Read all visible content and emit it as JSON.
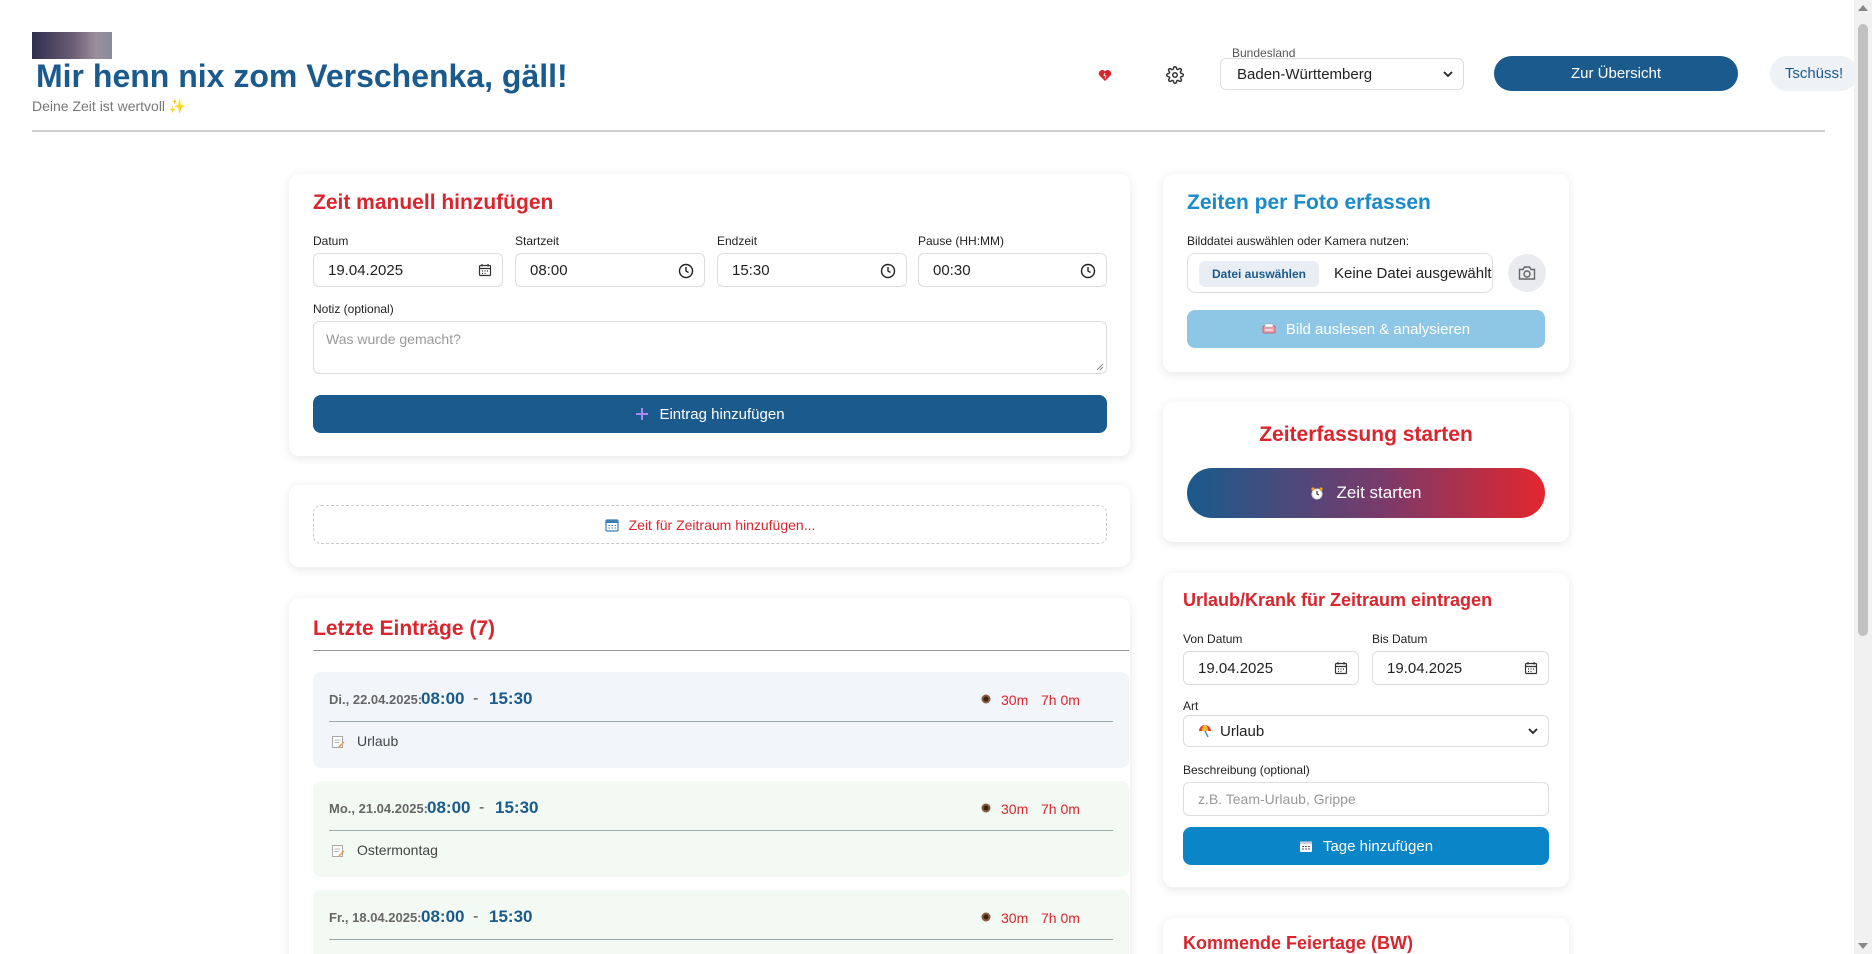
{
  "header": {
    "title": "Mir henn nix zom Verschenka, gäll!",
    "subtitle": "Deine Zeit ist wertvoll ✨",
    "region_label": "Bundesland",
    "region_value": "Baden-Württemberg",
    "overview_label": "Zur Übersicht",
    "logout_label": "Tschüss!"
  },
  "manual": {
    "title": "Zeit manuell hinzufügen",
    "date_label": "Datum",
    "date_value": "19.04.2025",
    "start_label": "Startzeit",
    "start_value": "08:00",
    "end_label": "Endzeit",
    "end_value": "15:30",
    "pause_label": "Pause (HH:MM)",
    "pause_value": "00:30",
    "note_label": "Notiz (optional)",
    "note_placeholder": "Was wurde gemacht?",
    "add_label": "Eintrag hinzufügen"
  },
  "range_add_label": "Zeit für Zeitraum hinzufügen...",
  "recent": {
    "title": "Letzte Einträge (7)",
    "entries": [
      {
        "date": "Di., 22.04.2025:",
        "start": "08:00",
        "end": "15:30",
        "pause": "30m",
        "duration": "7h 0m",
        "note": "Urlaub"
      },
      {
        "date": "Mo., 21.04.2025:",
        "start": "08:00",
        "end": "15:30",
        "pause": "30m",
        "duration": "7h 0m",
        "note": "Ostermontag"
      },
      {
        "date": "Fr., 18.04.2025:",
        "start": "08:00",
        "end": "15:30",
        "pause": "30m",
        "duration": "7h 0m",
        "note": ""
      }
    ]
  },
  "photo": {
    "title": "Zeiten per Foto erfassen",
    "hint": "Bilddatei auswählen oder Kamera nutzen:",
    "file_button": "Datei auswählen",
    "file_none": "Keine Datei ausgewählt",
    "analyze_label": "Bild auslesen & analysieren"
  },
  "tracking": {
    "title": "Zeiterfassung starten",
    "start_label": "Zeit starten"
  },
  "leave": {
    "title": "Urlaub/Krank für Zeitraum eintragen",
    "from_label": "Von Datum",
    "from_value": "19.04.2025",
    "to_label": "Bis Datum",
    "to_value": "19.04.2025",
    "type_label": "Art",
    "type_value": "Urlaub",
    "desc_label": "Beschreibung (optional)",
    "desc_placeholder": "z.B. Team-Urlaub, Grippe",
    "add_label": "Tage hinzufügen"
  },
  "holidays": {
    "title": "Kommende Feiertage (BW)"
  },
  "colors": {
    "primary": "#1a5a8c",
    "accent_red": "#d9262e",
    "accent_blue": "#0a86c8"
  }
}
